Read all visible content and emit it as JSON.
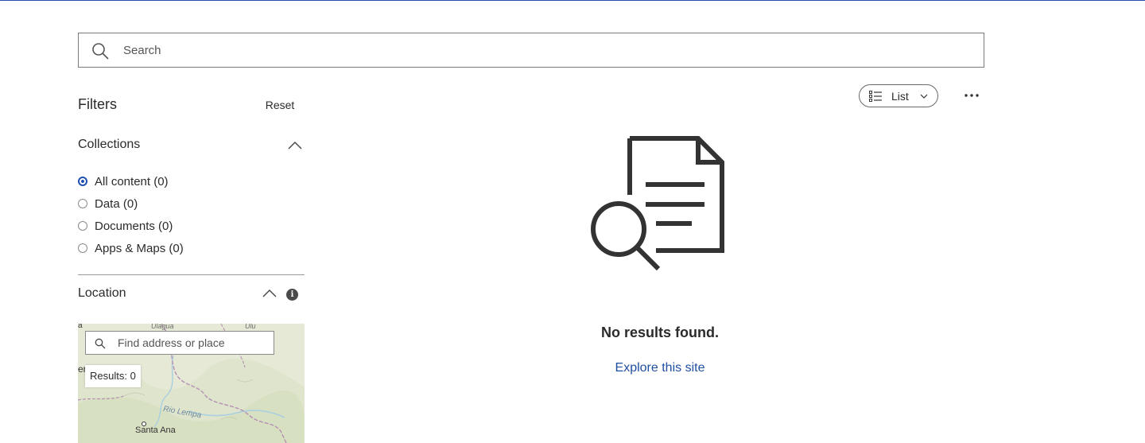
{
  "search": {
    "placeholder": "Search"
  },
  "filters": {
    "title": "Filters",
    "reset_label": "Reset",
    "collections": {
      "label": "Collections",
      "options": [
        {
          "label": "All content (0)",
          "checked": true
        },
        {
          "label": "Data (0)",
          "checked": false
        },
        {
          "label": "Documents (0)",
          "checked": false
        },
        {
          "label": "Apps & Maps (0)",
          "checked": false
        }
      ]
    },
    "location": {
      "label": "Location",
      "info_icon_glyph": "i",
      "map": {
        "search_placeholder": "Find address or place",
        "results_label": "Results: 0",
        "labels": {
          "top_a": "Ulagua",
          "top_b": "Ulu",
          "left_edge": "er",
          "left_edge_b": "a",
          "river": "Rio Lempa",
          "city": "Santa Ana"
        }
      }
    }
  },
  "toolbar": {
    "view_label": "List",
    "more_icon": "ellipsis-icon"
  },
  "empty_state": {
    "title": "No results found.",
    "link_label": "Explore this site"
  },
  "colors": {
    "accent": "#1f4fb0",
    "link": "#1f4fa0",
    "top_border": "#2a4fa8",
    "text": "#2b2b2b"
  }
}
